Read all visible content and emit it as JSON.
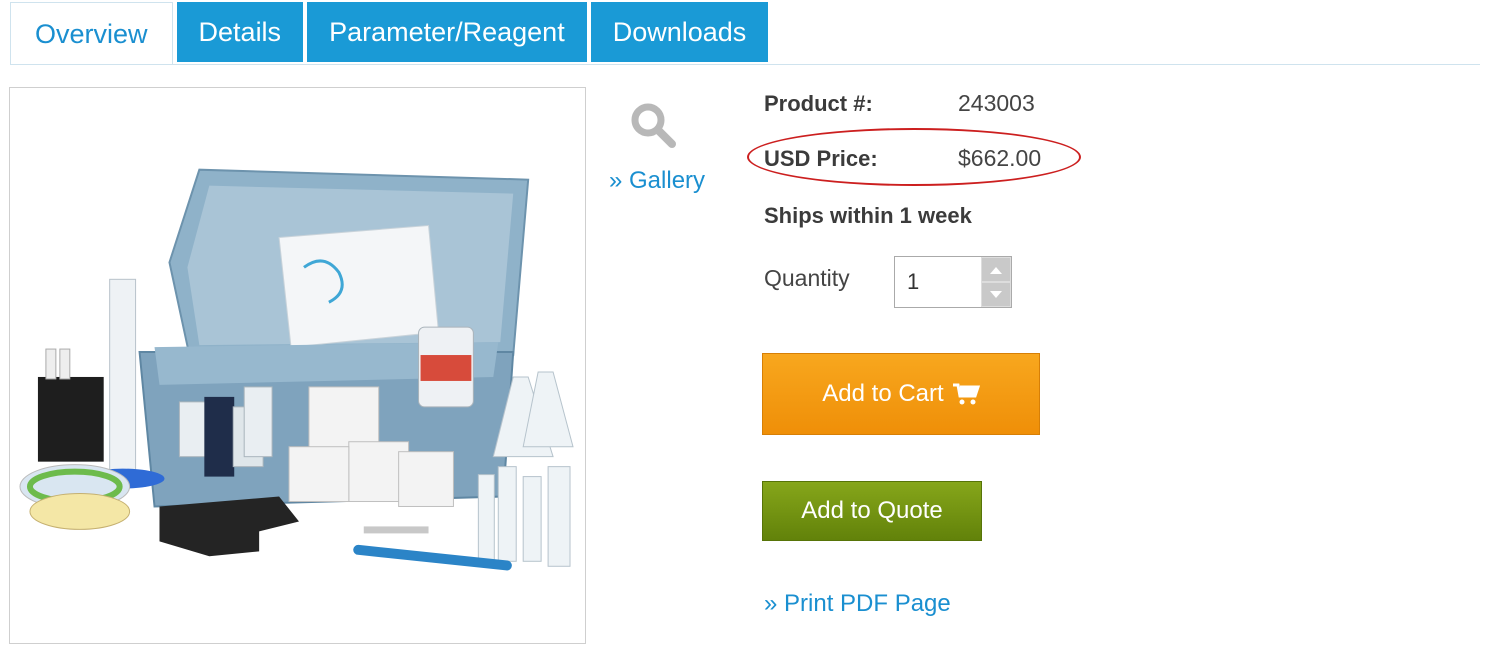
{
  "tabs": [
    {
      "label": "Overview",
      "active": true
    },
    {
      "label": "Details",
      "active": false
    },
    {
      "label": "Parameter/Reagent",
      "active": false
    },
    {
      "label": "Downloads",
      "active": false
    }
  ],
  "gallery": {
    "icon": "search-icon",
    "link": "» Gallery"
  },
  "product": {
    "number_label": "Product #:",
    "number_value": "243003",
    "price_label": "USD Price:",
    "price_value": "$662.00",
    "ships": "Ships within 1 week"
  },
  "quantity": {
    "label": "Quantity",
    "value": "1"
  },
  "buttons": {
    "add_to_cart": "Add to Cart",
    "add_to_quote": "Add to Quote"
  },
  "print_link": "» Print PDF Page",
  "colors": {
    "tab_blue": "#1a9ad6",
    "link_blue": "#1a8fd0",
    "cart_orange": "#f39a12",
    "quote_green": "#74941a",
    "highlight_red": "#cc1f1f"
  }
}
